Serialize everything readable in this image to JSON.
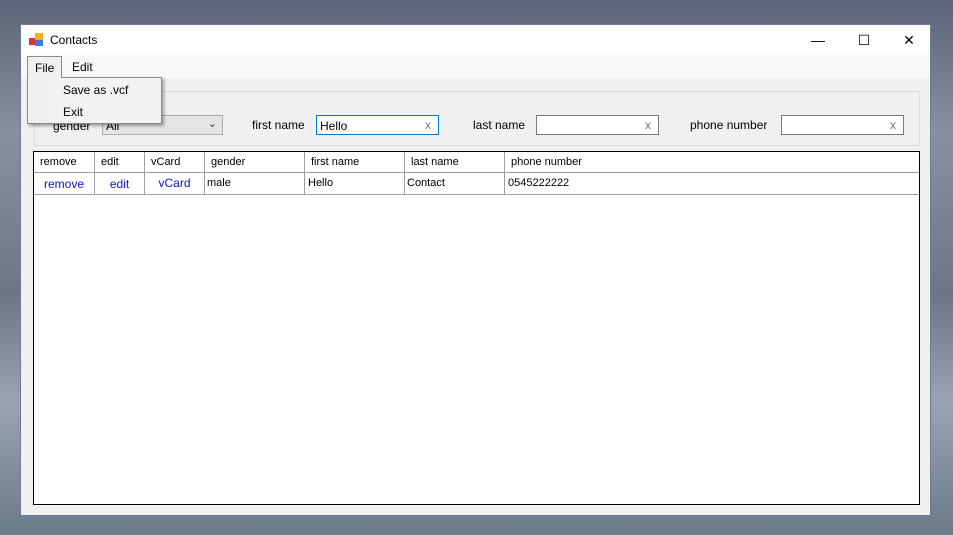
{
  "window": {
    "title": "Contacts",
    "controls": {
      "minimize": "—",
      "maximize": "☐",
      "close": "✕"
    }
  },
  "menu": {
    "items": [
      "File",
      "Edit"
    ],
    "file_dropdown": [
      "Save as .vcf",
      "Exit"
    ]
  },
  "filters": {
    "gender": {
      "label": "gender",
      "value": "All"
    },
    "first_name": {
      "label": "first name",
      "value": "Hello",
      "clear": "x"
    },
    "last_name": {
      "label": "last name",
      "value": "",
      "clear": "x"
    },
    "phone_number": {
      "label": "phone number",
      "value": "",
      "clear": "x"
    }
  },
  "table": {
    "columns": [
      "remove",
      "edit",
      "vCard",
      "gender",
      "first name",
      "last name",
      "phone number"
    ],
    "rows": [
      [
        "remove",
        "edit",
        "vCard",
        "male",
        "Hello",
        "Contact",
        "0545222222"
      ]
    ]
  }
}
